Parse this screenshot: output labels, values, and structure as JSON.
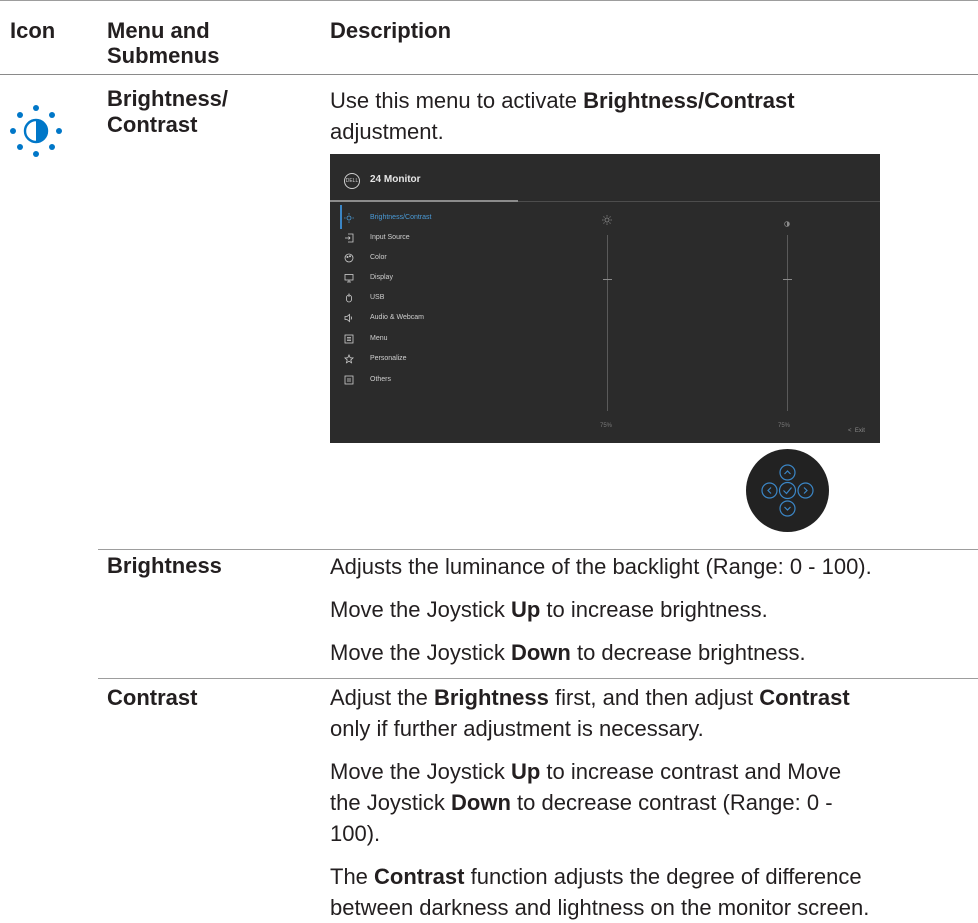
{
  "header": {
    "icon": "Icon",
    "menu_line1": "Menu and",
    "menu_line2": "Submenus",
    "description": "Description"
  },
  "row_main": {
    "icon_name": "brightness-contrast-icon",
    "title_line1": "Brightness/",
    "title_line2": "Contrast",
    "desc_pre": "Use this menu to activate ",
    "desc_bold": "Brightness/Contrast",
    "desc_post": "adjustment."
  },
  "osd": {
    "title": "24 Monitor",
    "menu_items": [
      {
        "label": "Brightness/Contrast",
        "icon": "sun-icon"
      },
      {
        "label": "Input Source",
        "icon": "input-icon"
      },
      {
        "label": "Color",
        "icon": "palette-icon"
      },
      {
        "label": "Display",
        "icon": "display-icon"
      },
      {
        "label": "USB",
        "icon": "usb-icon"
      },
      {
        "label": "Audio & Webcam",
        "icon": "audio-icon"
      },
      {
        "label": "Menu",
        "icon": "menu-icon"
      },
      {
        "label": "Personalize",
        "icon": "star-icon"
      },
      {
        "label": "Others",
        "icon": "others-icon"
      }
    ],
    "brightness_value": "75%",
    "contrast_value": "75%",
    "exit_label": "Exit",
    "accent": "#3b86c6"
  },
  "brightness": {
    "title": "Brightness",
    "line1": "Adjusts the luminance of the backlight (Range: 0 - 100).",
    "line2_pre": "Move the Joystick ",
    "line2_bold": "Up",
    "line2_post": " to increase brightness.",
    "line3_pre": "Move the Joystick ",
    "line3_bold": "Down",
    "line3_post": " to decrease brightness."
  },
  "contrast": {
    "title": "Contrast",
    "p1_a": "Adjust the ",
    "p1_b": "Brightness",
    "p1_c": " first, and then adjust ",
    "p1_d": "Contrast",
    "p1_e": "only if further adjustment is necessary.",
    "p2_a": "Move the Joystick ",
    "p2_b": "Up",
    "p2_c": " to increase contrast and Move",
    "p2_d": "the Joystick ",
    "p2_e": "Down",
    "p2_f": " to decrease contrast (Range: 0 -",
    "p2_g": "100).",
    "p3_a": "The ",
    "p3_b": "Contrast",
    "p3_c": " function adjusts the degree of difference",
    "p3_d": "between darkness and lightness on the monitor screen."
  }
}
